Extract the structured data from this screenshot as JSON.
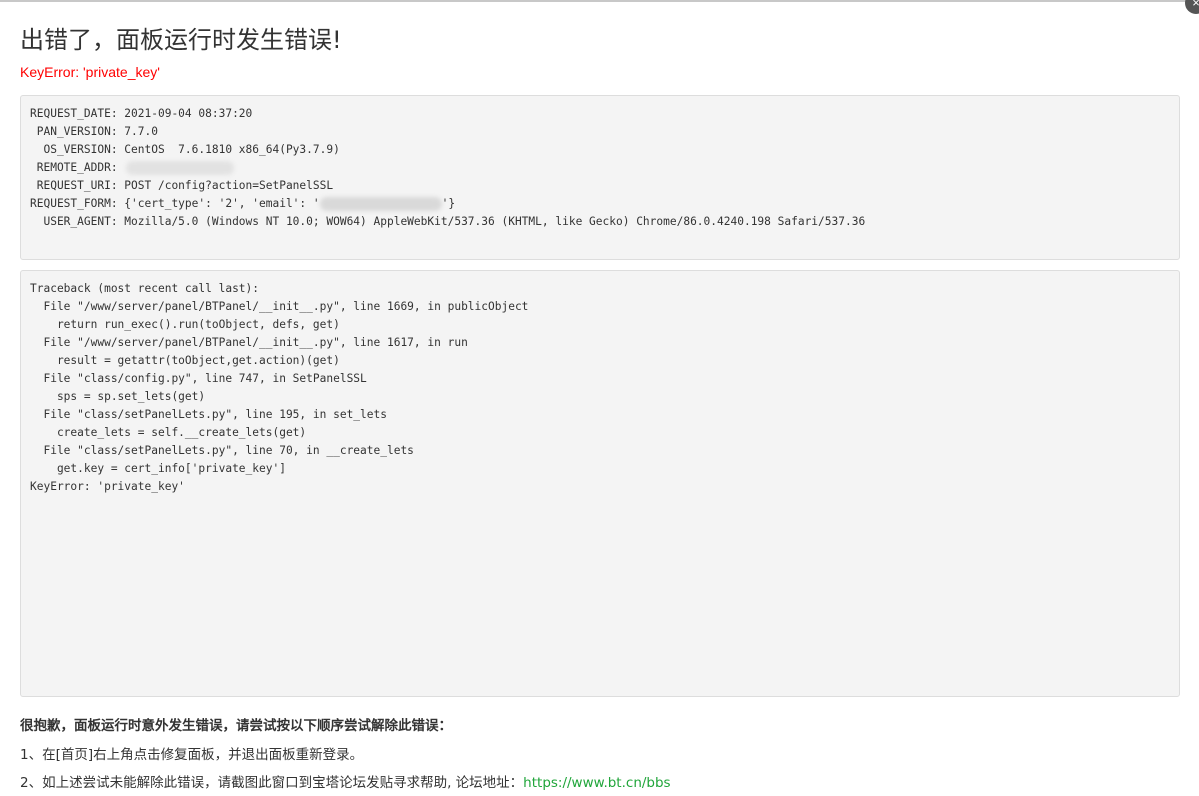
{
  "title": "出错了，面板运行时发生错误!",
  "error_message": "KeyError: 'private_key'",
  "request_info": {
    "line1": "REQUEST_DATE: 2021-09-04 08:37:20",
    "line2": " PAN_VERSION: 7.7.0",
    "line3": "  OS_VERSION: CentOS  7.6.1810 x86_64(Py3.7.9)",
    "line4_label": " REMOTE_ADDR: ",
    "line5": " REQUEST_URI: POST /config?action=SetPanelSSL",
    "line6_prefix": "REQUEST_FORM: {'cert_type': '2', 'email': '",
    "line6_suffix": "'}",
    "line7": "  USER_AGENT: Mozilla/5.0 (Windows NT 10.0; WOW64) AppleWebKit/537.36 (KHTML, like Gecko) Chrome/86.0.4240.198 Safari/537.36"
  },
  "traceback": "Traceback (most recent call last):\n  File \"/www/server/panel/BTPanel/__init__.py\", line 1669, in publicObject\n    return run_exec().run(toObject, defs, get)\n  File \"/www/server/panel/BTPanel/__init__.py\", line 1617, in run\n    result = getattr(toObject,get.action)(get)\n  File \"class/config.py\", line 747, in SetPanelSSL\n    sps = sp.set_lets(get)\n  File \"class/setPanelLets.py\", line 195, in set_lets\n    create_lets = self.__create_lets(get)\n  File \"class/setPanelLets.py\", line 70, in __create_lets\n    get.key = cert_info['private_key']\nKeyError: 'private_key'",
  "help": {
    "title": "很抱歉，面板运行时意外发生错误，请尝试按以下顺序尝试解除此错误：",
    "step1": "1、在[首页]右上角点击修复面板，并退出面板重新登录。",
    "step2_prefix": "2、如上述尝试未能解除此错误，请截图此窗口到宝塔论坛发贴寻求帮助, 论坛地址：",
    "step2_link": "https://www.bt.cn/bbs"
  },
  "close_glyph": "×"
}
